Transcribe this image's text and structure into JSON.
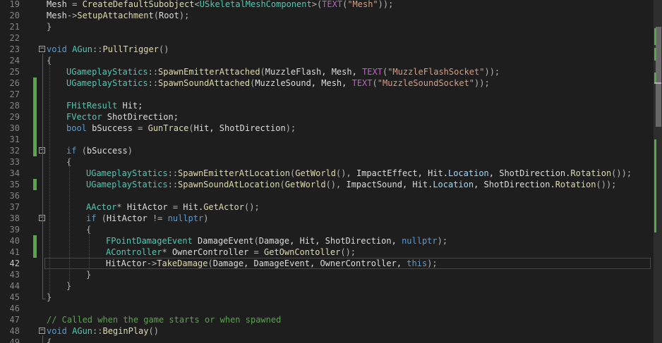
{
  "editor": {
    "lines": [
      {
        "n": "19",
        "change": false,
        "fold": "",
        "tokens": [
          [
            "pl",
            "Mesh "
          ],
          [
            "op",
            "= "
          ],
          [
            "fn",
            "CreateDefaultSubobject"
          ],
          [
            "op",
            "<"
          ],
          [
            "type",
            "USkeletalMeshComponent"
          ],
          [
            "op",
            ">("
          ],
          [
            "mac",
            "TEXT"
          ],
          [
            "op",
            "("
          ],
          [
            "str",
            "\"Mesh\""
          ],
          [
            "op",
            "));"
          ]
        ]
      },
      {
        "n": "20",
        "change": false,
        "fold": "",
        "tokens": [
          [
            "pl",
            "Mesh"
          ],
          [
            "op",
            "->"
          ],
          [
            "fn",
            "SetupAttachment"
          ],
          [
            "op",
            "("
          ],
          [
            "pl",
            "Root"
          ],
          [
            "op",
            ");"
          ]
        ]
      },
      {
        "n": "21",
        "change": false,
        "fold": "",
        "tokens": [
          [
            "op",
            "}"
          ]
        ]
      },
      {
        "n": "22",
        "change": false,
        "fold": "",
        "tokens": []
      },
      {
        "n": "23",
        "change": false,
        "fold": "minus",
        "tokens": [
          [
            "kw",
            "void "
          ],
          [
            "type",
            "AGun"
          ],
          [
            "op",
            "::"
          ],
          [
            "fn",
            "PullTrigger"
          ],
          [
            "op",
            "()"
          ]
        ]
      },
      {
        "n": "24",
        "change": false,
        "fold": "",
        "tokens": [
          [
            "op",
            "{"
          ]
        ]
      },
      {
        "n": "25",
        "change": false,
        "fold": "",
        "tokens": [
          [
            "type",
            "UGameplayStatics"
          ],
          [
            "op",
            "::"
          ],
          [
            "fn",
            "SpawnEmitterAttached"
          ],
          [
            "op",
            "("
          ],
          [
            "pl",
            "MuzzleFlash, Mesh, "
          ],
          [
            "mac",
            "TEXT"
          ],
          [
            "op",
            "("
          ],
          [
            "str",
            "\"MuzzleFlashSocket\""
          ],
          [
            "op",
            "));"
          ]
        ]
      },
      {
        "n": "26",
        "change": true,
        "fold": "",
        "tokens": [
          [
            "type",
            "UGameplayStatics"
          ],
          [
            "op",
            "::"
          ],
          [
            "fn",
            "SpawnSoundAttached"
          ],
          [
            "op",
            "("
          ],
          [
            "pl",
            "MuzzleSound, Mesh, "
          ],
          [
            "mac",
            "TEXT"
          ],
          [
            "op",
            "("
          ],
          [
            "str",
            "\"MuzzleSoundSocket\""
          ],
          [
            "op",
            "));"
          ]
        ]
      },
      {
        "n": "27",
        "change": true,
        "fold": "",
        "tokens": []
      },
      {
        "n": "28",
        "change": true,
        "fold": "",
        "tokens": [
          [
            "type",
            "FHitResult "
          ],
          [
            "pl",
            "Hit;"
          ]
        ]
      },
      {
        "n": "29",
        "change": true,
        "fold": "",
        "tokens": [
          [
            "type",
            "FVector "
          ],
          [
            "pl",
            "ShotDirection;"
          ]
        ]
      },
      {
        "n": "30",
        "change": true,
        "fold": "",
        "tokens": [
          [
            "kw",
            "bool "
          ],
          [
            "pl",
            "bSuccess "
          ],
          [
            "op",
            "= "
          ],
          [
            "fn",
            "GunTrace"
          ],
          [
            "op",
            "("
          ],
          [
            "pl",
            "Hit, ShotDirection"
          ],
          [
            "op",
            ");"
          ]
        ]
      },
      {
        "n": "31",
        "change": true,
        "fold": "",
        "tokens": []
      },
      {
        "n": "32",
        "change": true,
        "fold": "minus",
        "tokens": [
          [
            "kw",
            "if "
          ],
          [
            "op",
            "("
          ],
          [
            "pl",
            "bSuccess"
          ],
          [
            "op",
            ")"
          ]
        ]
      },
      {
        "n": "33",
        "change": false,
        "fold": "",
        "tokens": [
          [
            "op",
            "{"
          ]
        ]
      },
      {
        "n": "34",
        "change": false,
        "fold": "",
        "tokens": [
          [
            "type",
            "UGameplayStatics"
          ],
          [
            "op",
            "::"
          ],
          [
            "fn",
            "SpawnEmitterAtLocation"
          ],
          [
            "op",
            "("
          ],
          [
            "fn",
            "GetWorld"
          ],
          [
            "op",
            "(), "
          ],
          [
            "pl",
            "ImpactEffect, Hit."
          ],
          [
            "var",
            "Location"
          ],
          [
            "pl",
            ", ShotDirection."
          ],
          [
            "fn",
            "Rotation"
          ],
          [
            "op",
            "());"
          ]
        ]
      },
      {
        "n": "35",
        "change": true,
        "fold": "",
        "tokens": [
          [
            "type",
            "UGameplayStatics"
          ],
          [
            "op",
            "::"
          ],
          [
            "fn",
            "SpawnSoundAtLocation"
          ],
          [
            "op",
            "("
          ],
          [
            "fn",
            "GetWorld"
          ],
          [
            "op",
            "(), "
          ],
          [
            "pl",
            "ImpactSound, Hit."
          ],
          [
            "var",
            "Location"
          ],
          [
            "pl",
            ", ShotDirection."
          ],
          [
            "fn",
            "Rotation"
          ],
          [
            "op",
            "());"
          ]
        ]
      },
      {
        "n": "36",
        "change": false,
        "fold": "",
        "tokens": []
      },
      {
        "n": "37",
        "change": false,
        "fold": "",
        "tokens": [
          [
            "type",
            "AActor"
          ],
          [
            "op",
            "* "
          ],
          [
            "pl",
            "HitActor "
          ],
          [
            "op",
            "= "
          ],
          [
            "pl",
            "Hit."
          ],
          [
            "fn",
            "GetActor"
          ],
          [
            "op",
            "();"
          ]
        ]
      },
      {
        "n": "38",
        "change": false,
        "fold": "minus",
        "tokens": [
          [
            "kw",
            "if "
          ],
          [
            "op",
            "("
          ],
          [
            "pl",
            "HitActor "
          ],
          [
            "op",
            "!= "
          ],
          [
            "kw",
            "nullptr"
          ],
          [
            "op",
            ")"
          ]
        ]
      },
      {
        "n": "39",
        "change": false,
        "fold": "",
        "tokens": [
          [
            "op",
            "{"
          ]
        ]
      },
      {
        "n": "40",
        "change": true,
        "fold": "",
        "tokens": [
          [
            "type",
            "FPointDamageEvent "
          ],
          [
            "pl",
            "DamageEvent"
          ],
          [
            "op",
            "("
          ],
          [
            "pl",
            "Damage, Hit, ShotDirection, "
          ],
          [
            "kw",
            "nullptr"
          ],
          [
            "op",
            ");"
          ]
        ]
      },
      {
        "n": "41",
        "change": true,
        "fold": "",
        "tokens": [
          [
            "type",
            "AController"
          ],
          [
            "op",
            "* "
          ],
          [
            "pl",
            "OwnerController "
          ],
          [
            "op",
            "= "
          ],
          [
            "fn",
            "GetOwnContoller"
          ],
          [
            "op",
            "();"
          ]
        ]
      },
      {
        "n": "42",
        "change": false,
        "fold": "",
        "current": true,
        "tokens": [
          [
            "pl",
            "HitActor"
          ],
          [
            "op",
            "->"
          ],
          [
            "fn",
            "TakeDamage"
          ],
          [
            "op",
            "("
          ],
          [
            "pl",
            "Damage, DamageEvent, OwnerController, "
          ],
          [
            "kw",
            "this"
          ],
          [
            "op",
            ");"
          ]
        ]
      },
      {
        "n": "43",
        "change": false,
        "fold": "",
        "tokens": [
          [
            "op",
            "}"
          ]
        ]
      },
      {
        "n": "44",
        "change": false,
        "fold": "",
        "tokens": [
          [
            "op",
            "}"
          ]
        ]
      },
      {
        "n": "45",
        "change": false,
        "fold": "",
        "tokens": [
          [
            "op",
            "}"
          ]
        ]
      },
      {
        "n": "46",
        "change": false,
        "fold": "",
        "tokens": []
      },
      {
        "n": "47",
        "change": false,
        "fold": "",
        "tokens": [
          [
            "cm",
            "// Called when the game starts or when spawned"
          ]
        ]
      },
      {
        "n": "48",
        "change": false,
        "fold": "minus",
        "tokens": [
          [
            "kw",
            "void "
          ],
          [
            "type",
            "AGun"
          ],
          [
            "op",
            "::"
          ],
          [
            "fn",
            "BeginPlay"
          ],
          [
            "op",
            "()"
          ]
        ]
      },
      {
        "n": "49",
        "change": false,
        "fold": "",
        "tokens": [
          [
            "op",
            "{"
          ]
        ]
      },
      {
        "n": "50",
        "change": false,
        "fold": "",
        "tokens": [
          [
            "type",
            "Super"
          ],
          [
            "op",
            "::"
          ],
          [
            "fn",
            "BeginPlay"
          ],
          [
            "op",
            "();"
          ]
        ]
      }
    ],
    "colors": {
      "background": "#1e1e1e",
      "change_bar": "#57a64a",
      "keyword": "#569cd6",
      "type": "#4ec9b0",
      "function": "#dcdcaa",
      "string": "#d69d85",
      "comment": "#57a64a",
      "macro": "#bd63c5",
      "member": "#9cdcfe"
    }
  }
}
